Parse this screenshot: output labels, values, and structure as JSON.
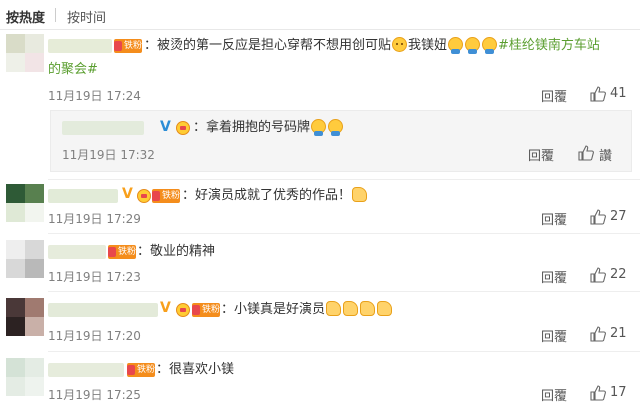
{
  "sort": {
    "hot": "按热度",
    "time": "按时间"
  },
  "vip_label": "铁粉",
  "comments": [
    {
      "text": "：被烫的第一反应是担心穿帮不想用创可贴",
      "text_mid": "我镁妞",
      "hashtag1": "#桂纶镁南方车站",
      "hashtag2": "的聚会#",
      "time": "11月19日 17:24",
      "reply": "回覆",
      "likes": "41"
    },
    {
      "text": "：拿着拥抱的号码牌",
      "time": "11月19日 17:32",
      "reply": "回覆",
      "likes": "讚"
    },
    {
      "text": "：好演员成就了优秀的作品！",
      "time": "11月19日 17:29",
      "reply": "回覆",
      "likes": "27"
    },
    {
      "text": "：敬业的精神",
      "time": "11月19日 17:23",
      "reply": "回覆",
      "likes": "22"
    },
    {
      "text": "：小镁真是好演员",
      "time": "11月19日 17:20",
      "reply": "回覆",
      "likes": "21"
    },
    {
      "text": "：很喜欢小镁",
      "time": "11月19日 17:25",
      "reply": "回覆",
      "likes": "17"
    }
  ],
  "icons": {
    "like": "thumbs-up-icon",
    "hug": "hug-emoji-icon",
    "pleading": "pleading-face-emoji-icon",
    "thumb": "thumbs-up-emoji-icon",
    "vip": "fan-badge-icon",
    "verified": "verified-v-icon"
  },
  "colors": {
    "hashtag": "#5a9e2f",
    "vip_badge": "#f48d1c",
    "text": "#333333",
    "meta": "#808080"
  }
}
